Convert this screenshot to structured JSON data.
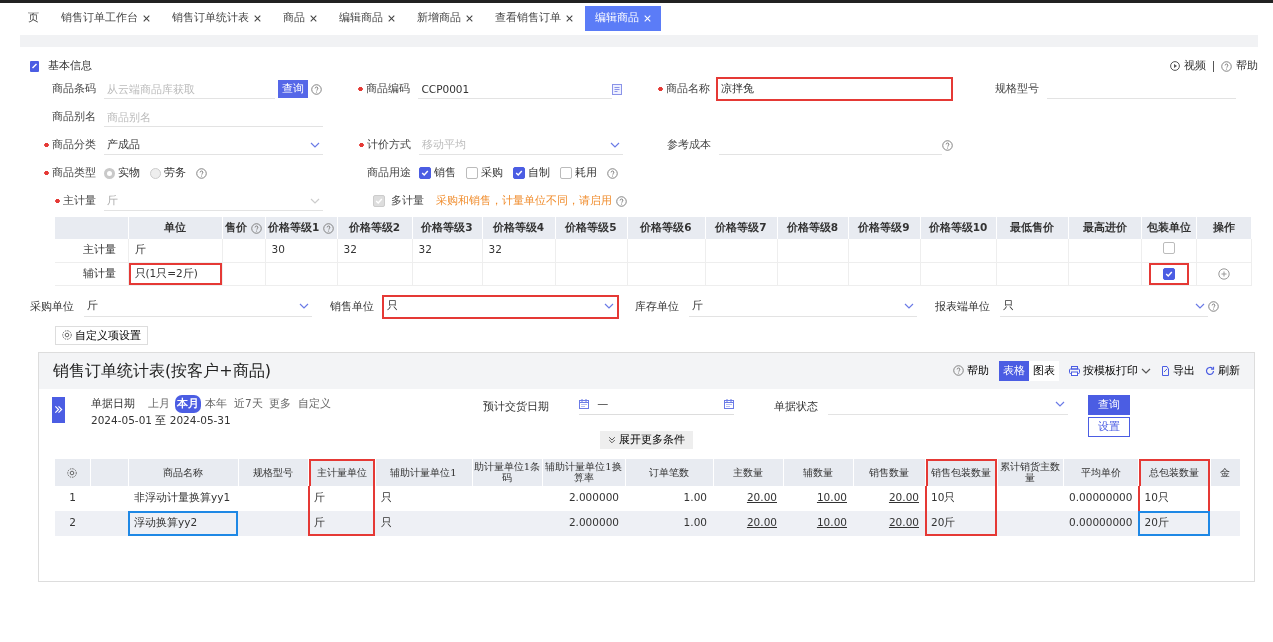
{
  "tabs": [
    {
      "label": "页",
      "closable": false,
      "selected": false
    },
    {
      "label": "销售订单工作台",
      "closable": true,
      "selected": false
    },
    {
      "label": "销售订单统计表",
      "closable": true,
      "selected": false
    },
    {
      "label": "商品",
      "closable": true,
      "selected": false
    },
    {
      "label": "编辑商品",
      "closable": true,
      "selected": false
    },
    {
      "label": "新增商品",
      "closable": true,
      "selected": false
    },
    {
      "label": "查看销售订单",
      "closable": true,
      "selected": false
    },
    {
      "label": "编辑商品",
      "closable": true,
      "selected": true
    }
  ],
  "form": {
    "title": "基本信息",
    "links": [
      {
        "kind": "video",
        "label": "视频"
      },
      {
        "kind": "help",
        "label": "帮助"
      }
    ],
    "rows": [
      [
        {
          "kind": "text",
          "label": "商品条码",
          "placeholder": "从云端商品库获取",
          "button": "查询",
          "help": true
        },
        {
          "kind": "text",
          "label": "商品编码",
          "required": true,
          "value": "CCP0001",
          "picker": true
        },
        {
          "kind": "text",
          "label": "商品名称",
          "required": true,
          "value": "凉拌兔",
          "marked": true
        },
        {
          "kind": "text",
          "label": "规格型号"
        }
      ],
      [
        {
          "kind": "text",
          "label": "商品别名",
          "placeholder": "商品别名"
        }
      ],
      [
        {
          "kind": "select",
          "label": "商品分类",
          "required": true,
          "value": "产成品"
        },
        {
          "kind": "select",
          "label": "计价方式",
          "required": true,
          "placeholder": "移动平均"
        },
        {
          "kind": "text",
          "label": "参考成本",
          "help": true
        }
      ],
      [
        {
          "kind": "radio",
          "label": "商品类型",
          "required": true,
          "options": [
            {
              "label": "实物",
              "selected": true
            },
            {
              "label": "劳务",
              "selected": false
            }
          ],
          "help": true
        },
        {
          "kind": "checks",
          "label": "商品用途",
          "options": [
            {
              "label": "销售",
              "checked": true
            },
            {
              "label": "采购",
              "checked": false
            },
            {
              "label": "自制",
              "checked": true
            },
            {
              "label": "耗用",
              "checked": false
            }
          ],
          "help": true
        }
      ],
      [
        {
          "kind": "select",
          "label": "主计量",
          "required": true,
          "value": "斤",
          "disabled": true
        },
        {
          "kind": "switch",
          "label": "多计量",
          "checked": true,
          "disabled": true,
          "note": "采购和销售，计量单位不同，请启用",
          "help": true
        }
      ]
    ]
  },
  "units": {
    "columns": [
      {
        "kind": "blank"
      },
      {
        "kind": "text",
        "label": "单位"
      },
      {
        "kind": "text",
        "label": "售价",
        "help": true
      },
      {
        "kind": "text",
        "label": "价格等级1",
        "help": true
      },
      {
        "kind": "text",
        "label": "价格等级2"
      },
      {
        "kind": "text",
        "label": "价格等级3"
      },
      {
        "kind": "text",
        "label": "价格等级4"
      },
      {
        "kind": "text",
        "label": "价格等级5"
      },
      {
        "kind": "text",
        "label": "价格等级6"
      },
      {
        "kind": "text",
        "label": "价格等级7"
      },
      {
        "kind": "text",
        "label": "价格等级8"
      },
      {
        "kind": "text",
        "label": "价格等级9"
      },
      {
        "kind": "text",
        "label": "价格等级10"
      },
      {
        "kind": "text",
        "label": "最低售价"
      },
      {
        "kind": "text",
        "label": "最高进价"
      },
      {
        "kind": "text",
        "label": "包装单位"
      },
      {
        "kind": "text",
        "label": "操作"
      }
    ],
    "rows": [
      {
        "label": "主计量",
        "unit": "斤",
        "prices": [
          "30",
          "32",
          "32",
          "32"
        ],
        "packing": false
      },
      {
        "label": "辅计量",
        "unit": "只(1只=2斤)",
        "packing": true,
        "add": true,
        "unit_marked": true,
        "packing_marked": true
      }
    ]
  },
  "unit_selects": [
    {
      "label": "采购单位",
      "value": "斤"
    },
    {
      "label": "销售单位",
      "value": "只",
      "marked": true
    },
    {
      "label": "库存单位",
      "value": "斤"
    },
    {
      "label": "报表端单位",
      "value": "只",
      "help": true
    }
  ],
  "custom_button": "自定义项设置",
  "report": {
    "title": "销售订单统计表(按客户+商品)",
    "toolbar": {
      "help": "帮助",
      "views": [
        {
          "label": "表格",
          "selected": true
        },
        {
          "label": "图表",
          "selected": false
        }
      ],
      "print": "按模板打印",
      "export": "导出",
      "refresh": "刷新"
    },
    "filters": {
      "date_label": "单据日期",
      "presets": [
        {
          "label": "上月",
          "selected": false
        },
        {
          "label": "本月",
          "selected": true
        },
        {
          "label": "本年",
          "selected": false
        },
        {
          "label": "近7天",
          "selected": false
        },
        {
          "label": "更多",
          "selected": false
        },
        {
          "label": "自定义",
          "selected": false
        }
      ],
      "range": "2024-05-01 至 2024-05-31",
      "delivery_label": "预计交货日期",
      "delivery_sep": "—",
      "status_label": "单据状态",
      "query": "查询",
      "settings": "设置",
      "more": "展开更多条件"
    },
    "table": {
      "columns": [
        {
          "kind": "gear"
        },
        {
          "kind": "blank"
        },
        {
          "kind": "text",
          "label": "商品名称"
        },
        {
          "kind": "text",
          "label": "规格型号"
        },
        {
          "kind": "text",
          "label": "主计量单位",
          "marked": true
        },
        {
          "kind": "text",
          "label": "辅助计量单位1"
        },
        {
          "kind": "text",
          "label": "助计量单位1条码"
        },
        {
          "kind": "number",
          "label": "辅助计量单位1换算率"
        },
        {
          "kind": "number",
          "label": "订单笔数"
        },
        {
          "kind": "link",
          "label": "主数量"
        },
        {
          "kind": "link",
          "label": "辅数量"
        },
        {
          "kind": "link",
          "label": "销售数量"
        },
        {
          "kind": "text",
          "label": "销售包装数量",
          "marked": true
        },
        {
          "kind": "number",
          "label": "累计销货主数量"
        },
        {
          "kind": "number",
          "label": "平均单价"
        },
        {
          "kind": "text",
          "label": "总包装数量",
          "marked": true
        },
        {
          "kind": "text",
          "label": "金"
        }
      ],
      "rows": [
        {
          "cells": [
            "1",
            null,
            "非浮动计量换算yy1",
            null,
            "斤",
            "只",
            null,
            "2.000000",
            "1.00",
            "20.00",
            "10.00",
            "20.00",
            "10只",
            null,
            "0.00000000",
            "10只",
            null
          ]
        },
        {
          "cells": [
            "2",
            null,
            {
              "text": "浮动换算yy2",
              "marked": true
            },
            null,
            "斤",
            "只",
            null,
            "2.000000",
            "1.00",
            "20.00",
            "10.00",
            "20.00",
            "20斤",
            null,
            "0.00000000",
            {
              "text": "20斤",
              "marked": true
            },
            null
          ]
        }
      ]
    }
  }
}
